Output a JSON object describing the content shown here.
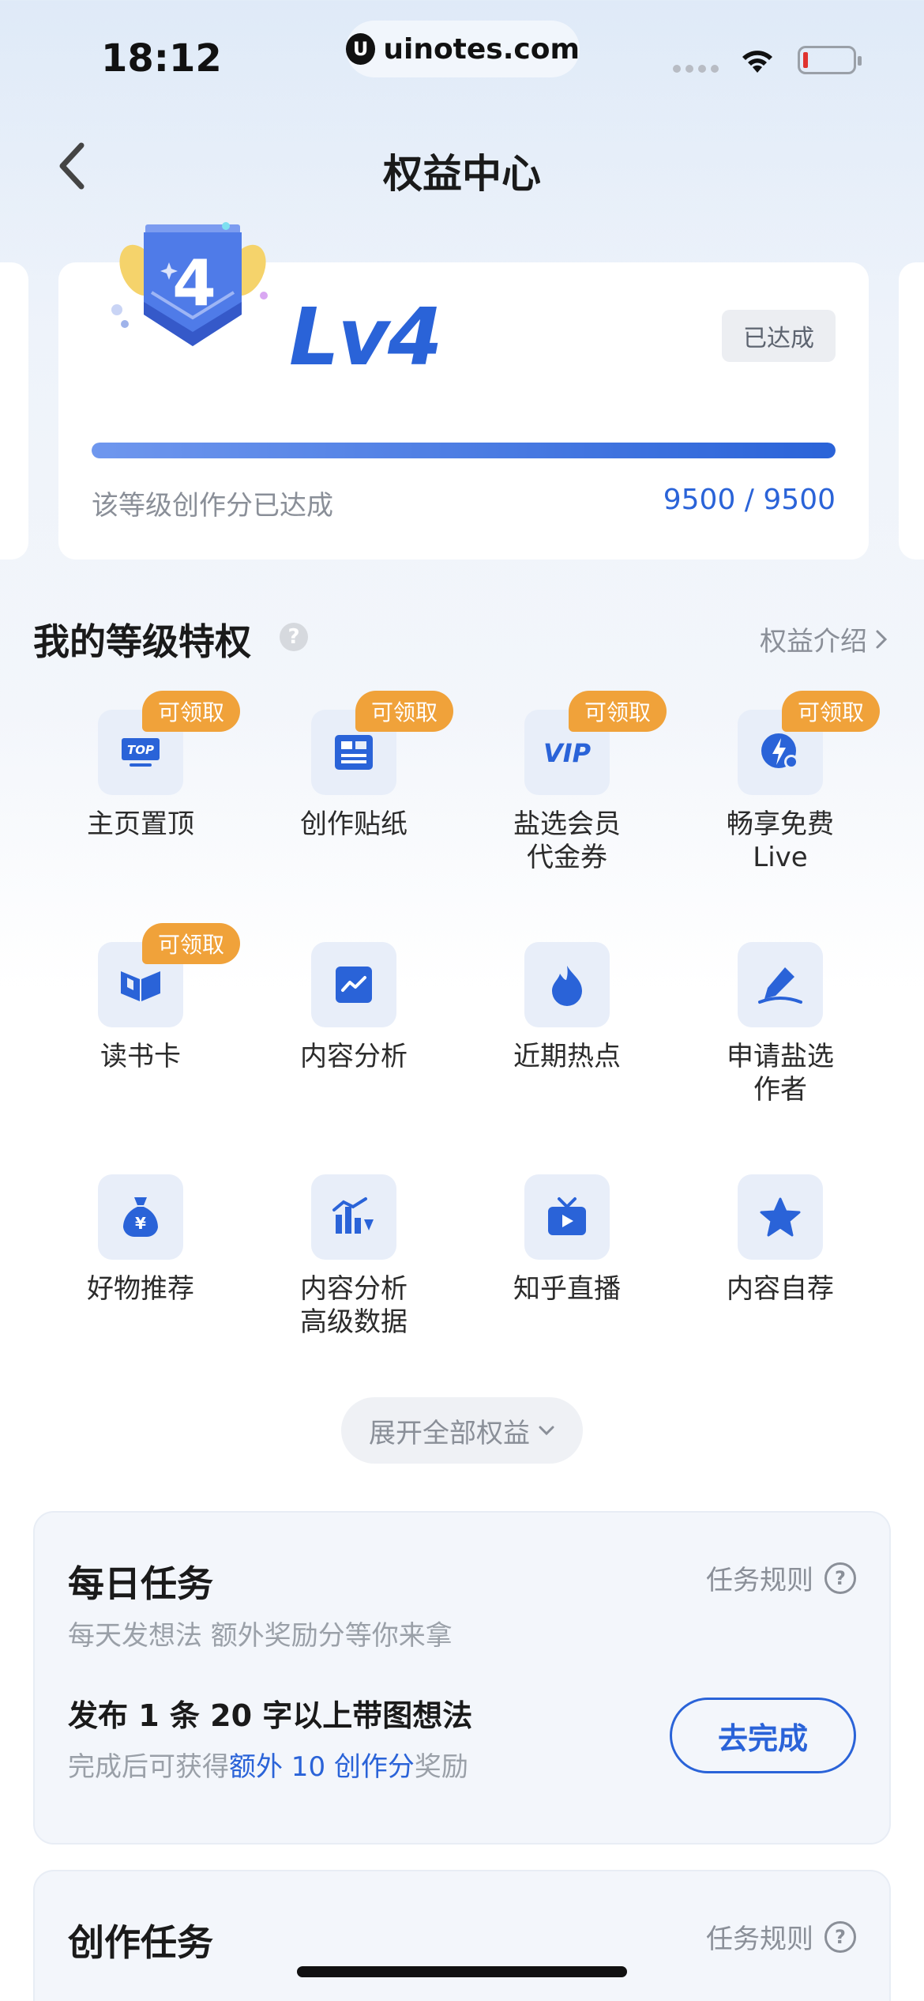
{
  "status_bar": {
    "time": "18:12",
    "url": "uinotes.com",
    "url_logo": "U"
  },
  "nav": {
    "title": "权益中心"
  },
  "level_card": {
    "badge_number": "4",
    "level": "Lv4",
    "status_tag": "已达成",
    "progress_fraction": 1.0,
    "progress_caption": "该等级创作分已达成",
    "progress_value": "9500 / 9500"
  },
  "privileges": {
    "title": "我的等级特权",
    "help": "?",
    "intro_link": "权益介绍",
    "items": [
      {
        "label": "主页置顶",
        "icon": "top-icon",
        "claim": "可领取"
      },
      {
        "label": "创作贴纸",
        "icon": "sticker-icon",
        "claim": "可领取"
      },
      {
        "label": "盐选会员\n代金券",
        "icon": "vip-icon",
        "claim": "可领取"
      },
      {
        "label": "畅享免费\nLive",
        "icon": "live-icon",
        "claim": "可领取"
      },
      {
        "label": "读书卡",
        "icon": "book-icon",
        "claim": "可领取"
      },
      {
        "label": "内容分析",
        "icon": "chart-icon",
        "claim": ""
      },
      {
        "label": "近期热点",
        "icon": "flame-icon",
        "claim": ""
      },
      {
        "label": "申请盐选\n作者",
        "icon": "pen-icon",
        "claim": ""
      },
      {
        "label": "好物推荐",
        "icon": "money-bag-icon",
        "claim": ""
      },
      {
        "label": "内容分析\n高级数据",
        "icon": "advanced-chart-icon",
        "claim": ""
      },
      {
        "label": "知乎直播",
        "icon": "tv-icon",
        "claim": ""
      },
      {
        "label": "内容自荐",
        "icon": "star-icon",
        "claim": ""
      }
    ],
    "expand_label": "展开全部权益"
  },
  "daily_task": {
    "title": "每日任务",
    "rules": "任务规则",
    "subtitle": "每天发想法 额外奖励分等你来拿",
    "item_title": "发布 1 条 20 字以上带图想法",
    "desc_prefix": "完成后可获得",
    "desc_highlight": "额外 10 创作分",
    "desc_suffix": "奖励",
    "button": "去完成"
  },
  "create_task": {
    "title": "创作任务",
    "rules": "任务规则"
  },
  "colors": {
    "accent": "#2a63d8",
    "claim": "#f0a23a"
  }
}
